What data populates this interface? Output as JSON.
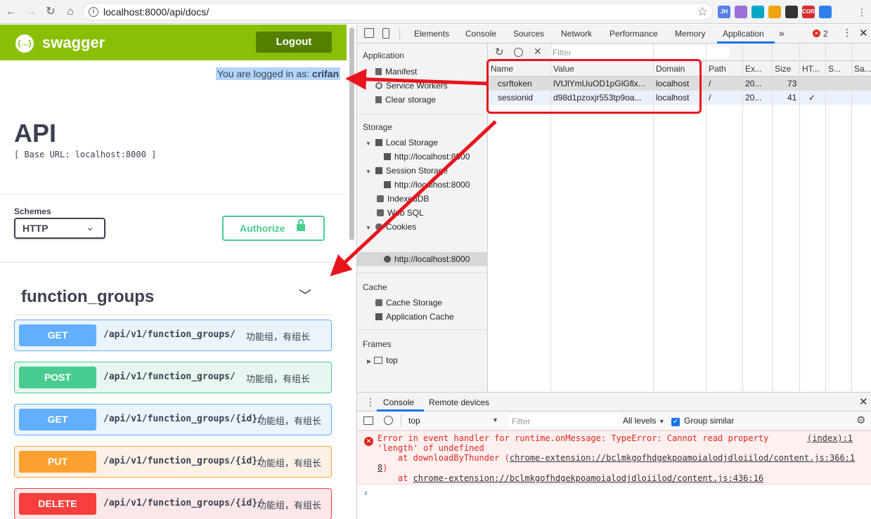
{
  "browser": {
    "url": "localhost:8000/api/docs/",
    "extensions": [
      {
        "label": "JH",
        "color": "#5a7fe6"
      },
      {
        "label": "",
        "color": "#9c6fd6"
      },
      {
        "label": "",
        "color": "#00a8c6"
      },
      {
        "label": "",
        "color": "#f0a30a"
      },
      {
        "label": "",
        "color": "#333333"
      },
      {
        "label": "CORS",
        "color": "#d32f2f"
      },
      {
        "label": "",
        "color": "#2f80ed"
      }
    ]
  },
  "swagger": {
    "logo_text": "swagger",
    "logout_label": "Logout",
    "logged_in_prefix": "You are logged in as: ",
    "logged_in_user": "crifan",
    "api_title": "API",
    "base_url": "[ Base URL: localhost:8000 ]",
    "schemes_label": "Schemes",
    "scheme_value": "HTTP",
    "authorize_label": "Authorize",
    "group_title": "function_groups",
    "operations": [
      {
        "method": "GET",
        "path": "/api/v1/function_groups/",
        "desc": "功能组，有组长",
        "color": "#61affe",
        "bg": "#ebf3fb"
      },
      {
        "method": "POST",
        "path": "/api/v1/function_groups/",
        "desc": "功能组，有组长",
        "color": "#49cc90",
        "bg": "#e8f6f0"
      },
      {
        "method": "GET",
        "path": "/api/v1/function_groups/{id}/",
        "desc": "功能组，有组长",
        "color": "#61affe",
        "bg": "#ebf3fb"
      },
      {
        "method": "PUT",
        "path": "/api/v1/function_groups/{id}/",
        "desc": "功能组，有组长",
        "color": "#fca130",
        "bg": "#fbf1e6"
      },
      {
        "method": "DELETE",
        "path": "/api/v1/function_groups/{id}/",
        "desc": "功能组，有组长",
        "color": "#f93e3e",
        "bg": "#fae7e7"
      }
    ]
  },
  "devtools": {
    "tabs": [
      "Elements",
      "Console",
      "Sources",
      "Network",
      "Performance",
      "Memory",
      "Application"
    ],
    "more": "»",
    "error_count": "2",
    "sidebar": {
      "application_header": "Application",
      "application_items": [
        "Manifest",
        "Service Workers",
        "Clear storage"
      ],
      "storage_header": "Storage",
      "local_storage": "Local Storage",
      "local_storage_origin": "http://localhost:8000",
      "session_storage": "Session Storage",
      "session_storage_origin": "http://localhost:8000",
      "indexeddb": "IndexedDB",
      "websql": "Web SQL",
      "cookies": "Cookies",
      "cookies_origin": "http://localhost:8000",
      "cache_header": "Cache",
      "cache_items": [
        "Cache Storage",
        "Application Cache"
      ],
      "frames_header": "Frames",
      "frames_top": "top"
    },
    "cookies": {
      "filter_placeholder": "Filter",
      "columns": [
        "Name",
        "Value",
        "Domain",
        "Path",
        "Ex...",
        "Size",
        "HT...",
        "S...",
        "Sa..."
      ],
      "rows": [
        {
          "name": "csrftoken",
          "value": "lVtJlYmUuOD1pGlGflx...",
          "domain": "localhost",
          "path": "/",
          "expires": "20...",
          "size": "73",
          "http": ""
        },
        {
          "name": "sessionid",
          "value": "d98d1pzoxjr553tp9oa...",
          "domain": "localhost",
          "path": "/",
          "expires": "20...",
          "size": "41",
          "http": "✓"
        }
      ]
    },
    "console": {
      "tabs": [
        "Console",
        "Remote devices"
      ],
      "context": "top",
      "filter_placeholder": "Filter",
      "levels": "All levels",
      "group_similar": "Group similar",
      "error_line1": "Error in event handler for runtime.onMessage: TypeError: Cannot read property",
      "error_line2": "'length' of undefined",
      "error_source": "(index):1",
      "stack1_prefix": "    at downloadByThunder (",
      "stack1_link": "chrome-extension://bclmkgofhdgekpoamoialodjdloiilod/content.js:366:1",
      "stack1_wrap": "8",
      "stack1_suffix": ")",
      "stack2_prefix": "    at ",
      "stack2_link": "chrome-extension://bclmkgofhdgekpoamoialodjdloiilod/content.js:436:16",
      "prompt": "›"
    }
  }
}
